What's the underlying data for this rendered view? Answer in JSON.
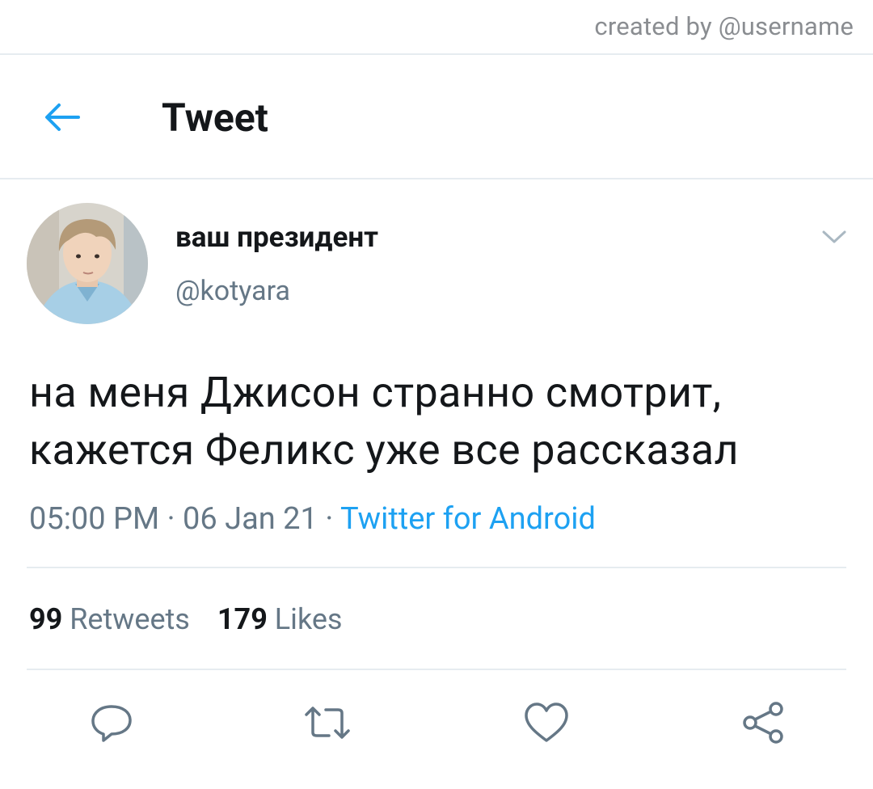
{
  "credit": "created by @username",
  "header": {
    "title": "Tweet",
    "back_icon": "arrow-left-icon"
  },
  "colors": {
    "accent": "#1da1f2",
    "muted": "#657786",
    "text": "#14171a",
    "divider": "#e6ecf0"
  },
  "tweet": {
    "display_name": "ваш президент",
    "handle": "@kotyara",
    "text_line1": "на меня Джисон странно смотрит,",
    "text_line2": "кажется Феликс уже все рассказал",
    "time": "05:00 PM",
    "sep1": " · ",
    "date": "06 Jan 21",
    "sep2": " · ",
    "source": "Twitter for Android"
  },
  "stats": {
    "retweets_count": "99",
    "retweets_label": "Retweets",
    "likes_count": "179",
    "likes_label": "Likes"
  },
  "actions": [
    "reply-icon",
    "retweet-icon",
    "like-icon",
    "share-icon"
  ]
}
